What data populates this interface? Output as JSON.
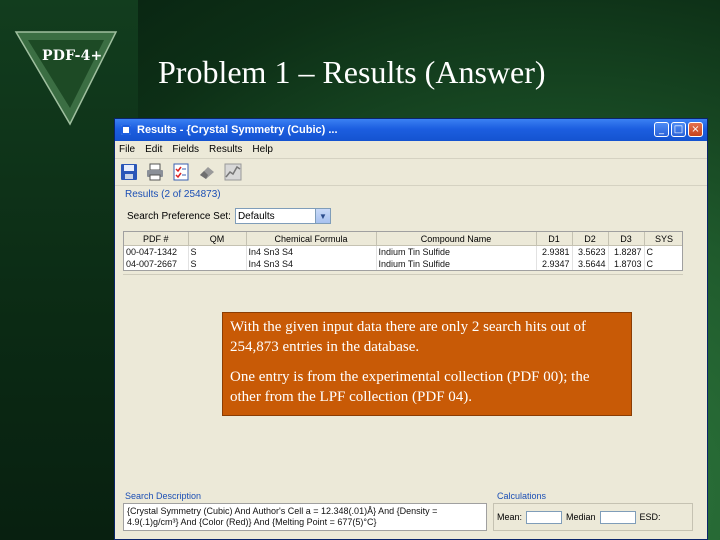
{
  "slide": {
    "logo_text": "PDF-4+",
    "title": "Problem 1 – Results (Answer)"
  },
  "window": {
    "title": "Results - {Crystal Symmetry (Cubic) ...",
    "buttons": {
      "minimize": "_",
      "maximize": "□",
      "close": "×"
    }
  },
  "menu": [
    "File",
    "Edit",
    "Fields",
    "Results",
    "Help"
  ],
  "toolbar_icons": [
    "save-icon",
    "print-icon",
    "checklist-icon",
    "eraser-icon",
    "graph-icon"
  ],
  "results": {
    "group_label": "Results (2 of 254873)",
    "search_pref_label": "Search Preference Set:",
    "search_pref_value": "Defaults",
    "columns": [
      "PDF #",
      "QM",
      "Chemical Formula",
      "Compound Name",
      "D1",
      "D2",
      "D3",
      "SYS"
    ],
    "rows": [
      [
        "00-047-1342",
        "S",
        "In4 Sn3 S4",
        "Indium Tin Sulfide",
        "2.9381",
        "3.5623",
        "1.8287",
        "C"
      ],
      [
        "04-007-2667",
        "S",
        "In4 Sn3 S4",
        "Indium Tin Sulfide",
        "2.9347",
        "3.5644",
        "1.8703",
        "C"
      ]
    ]
  },
  "callout": {
    "p1": "With the given input data there are only 2 search hits out of 254,873 entries in the database.",
    "p2": "One entry is from the experimental collection (PDF 00); the other from the LPF collection (PDF 04)."
  },
  "search_description": {
    "label": "Search Description",
    "text": "{Crystal Symmetry (Cubic) And Author's Cell a = 12.348(.01)Å} And {Density = 4.9(.1)g/cm³} And {Color (Red)} And {Melting Point = 677(5)°C}"
  },
  "calculations": {
    "label": "Calculations",
    "mean_label": "Mean:",
    "median_label": "Median",
    "esd_label": "ESD:"
  }
}
